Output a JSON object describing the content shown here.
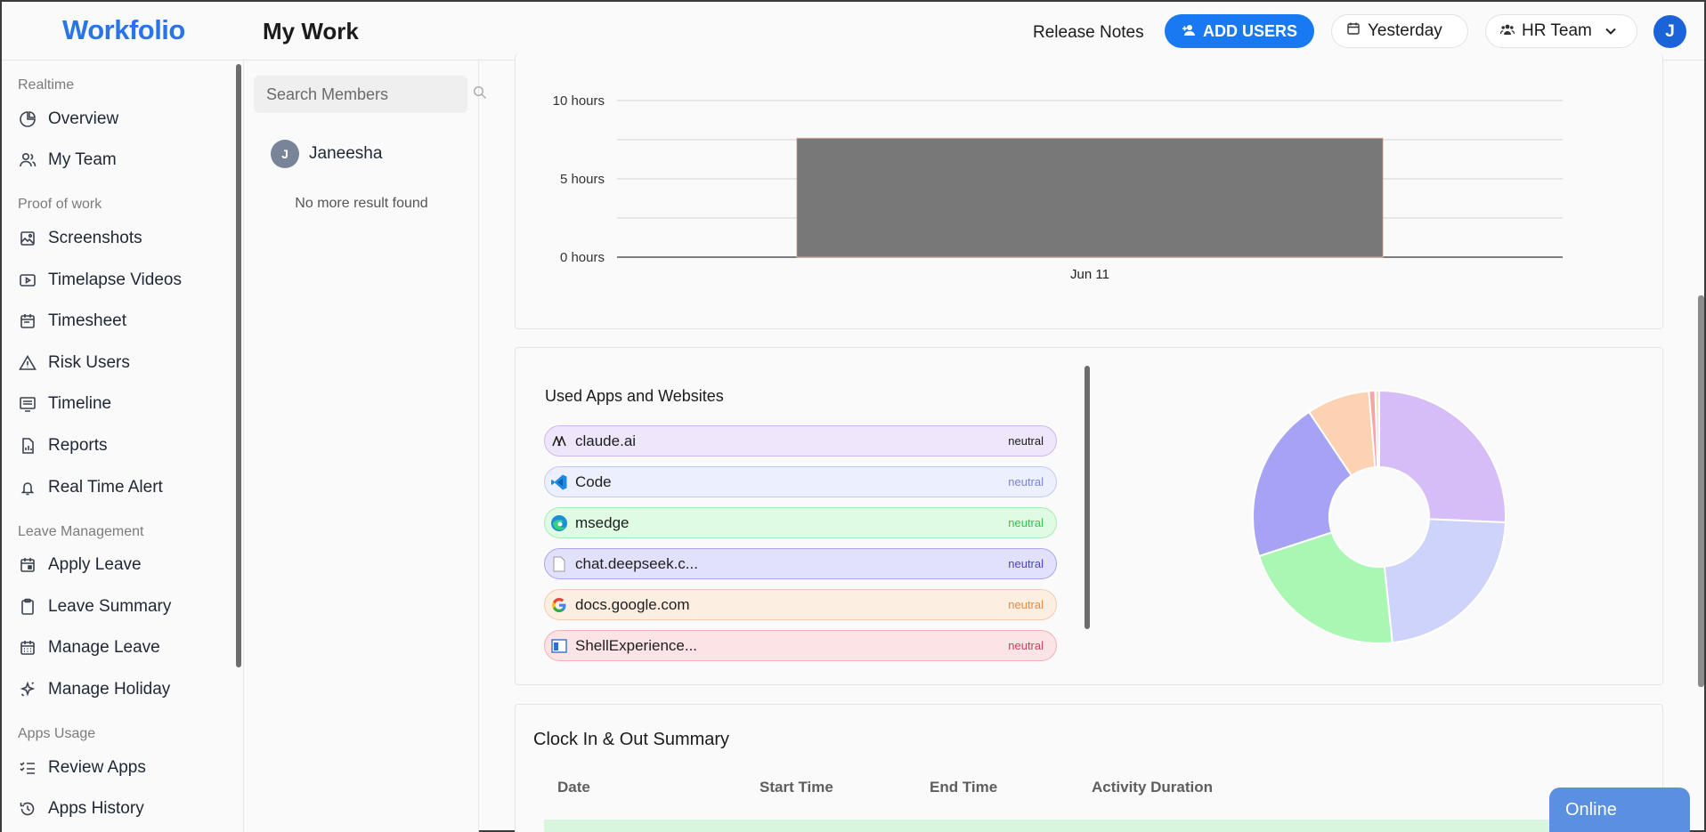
{
  "header": {
    "logo": "Workfolio",
    "page_title": "My Work",
    "release_notes": "Release Notes",
    "add_users": "ADD USERS",
    "date_filter": "Yesterday",
    "team_filter": "HR Team",
    "avatar_initial": "J"
  },
  "sidebar": {
    "sections": [
      {
        "label": "Realtime",
        "items": [
          {
            "label": "Overview",
            "icon": "pie-chart-icon"
          },
          {
            "label": "My Team",
            "icon": "team-icon"
          }
        ]
      },
      {
        "label": "Proof of work",
        "items": [
          {
            "label": "Screenshots",
            "icon": "image-icon"
          },
          {
            "label": "Timelapse Videos",
            "icon": "video-icon"
          },
          {
            "label": "Timesheet",
            "icon": "calendar-icon"
          },
          {
            "label": "Risk Users",
            "icon": "warning-icon"
          },
          {
            "label": "Timeline",
            "icon": "timeline-icon"
          },
          {
            "label": "Reports",
            "icon": "report-icon"
          },
          {
            "label": "Real Time Alert",
            "icon": "bell-icon"
          }
        ]
      },
      {
        "label": "Leave Management",
        "items": [
          {
            "label": "Apply Leave",
            "icon": "calendar-add-icon"
          },
          {
            "label": "Leave Summary",
            "icon": "clipboard-icon"
          },
          {
            "label": "Manage Leave",
            "icon": "calendar-grid-icon"
          },
          {
            "label": "Manage Holiday",
            "icon": "sparkle-icon"
          }
        ]
      },
      {
        "label": "Apps Usage",
        "items": [
          {
            "label": "Review Apps",
            "icon": "checklist-icon"
          },
          {
            "label": "Apps History",
            "icon": "history-icon"
          }
        ]
      }
    ]
  },
  "members": {
    "search_placeholder": "Search Members",
    "list": [
      {
        "name": "Janeesha",
        "initial": "J"
      }
    ],
    "no_more": "No more result found"
  },
  "chart_data": {
    "type": "bar",
    "categories": [
      "Jun 11"
    ],
    "values": [
      7.6
    ],
    "ylim": [
      0,
      10
    ],
    "yticks": [
      "0 hours",
      "5 hours",
      "10 hours"
    ],
    "grid": true,
    "color": "#787878"
  },
  "apps": {
    "title": "Used Apps and Websites",
    "list": [
      {
        "name": "claude.ai",
        "tag": "neutral",
        "bg": "#efe6fb",
        "border": "#cdb7f0",
        "tagColor": "#1a1a1a",
        "icon": "claude-icon"
      },
      {
        "name": "Code",
        "tag": "neutral",
        "bg": "#eceffd",
        "border": "#c4cbf3",
        "tagColor": "#7b84d6",
        "icon": "vscode-icon"
      },
      {
        "name": "msedge",
        "tag": "neutral",
        "bg": "#e0fbe3",
        "border": "#a6eeb0",
        "tagColor": "#35c24e",
        "icon": "edge-icon"
      },
      {
        "name": "chat.deepseek.c...",
        "tag": "neutral",
        "bg": "#e2e1fb",
        "border": "#a9a6ef",
        "tagColor": "#4a45c2",
        "icon": "file-icon"
      },
      {
        "name": "docs.google.com",
        "tag": "neutral",
        "bg": "#fdeee2",
        "border": "#f5ccac",
        "tagColor": "#e48c45",
        "icon": "google-icon"
      },
      {
        "name": "ShellExperience...",
        "tag": "neutral",
        "bg": "#fbe3e6",
        "border": "#f0b3bb",
        "tagColor": "#d0405a",
        "icon": "window-icon"
      }
    ],
    "donut": [
      {
        "value": 25.5,
        "color": "#d6bdf7"
      },
      {
        "value": 22.5,
        "color": "#cdd3fa"
      },
      {
        "value": 21.5,
        "color": "#a9f7b3"
      },
      {
        "value": 20.5,
        "color": "#a6a3f4"
      },
      {
        "value": 8.0,
        "color": "#fdd2b2"
      },
      {
        "value": 0.8,
        "color": "#f5a5a5"
      },
      {
        "value": 0.5,
        "color": "#f3e2c8"
      }
    ]
  },
  "clock": {
    "title": "Clock In & Out Summary",
    "columns": [
      "Date",
      "Start Time",
      "End Time",
      "Activity Duration"
    ]
  },
  "status": {
    "online": "Online"
  }
}
